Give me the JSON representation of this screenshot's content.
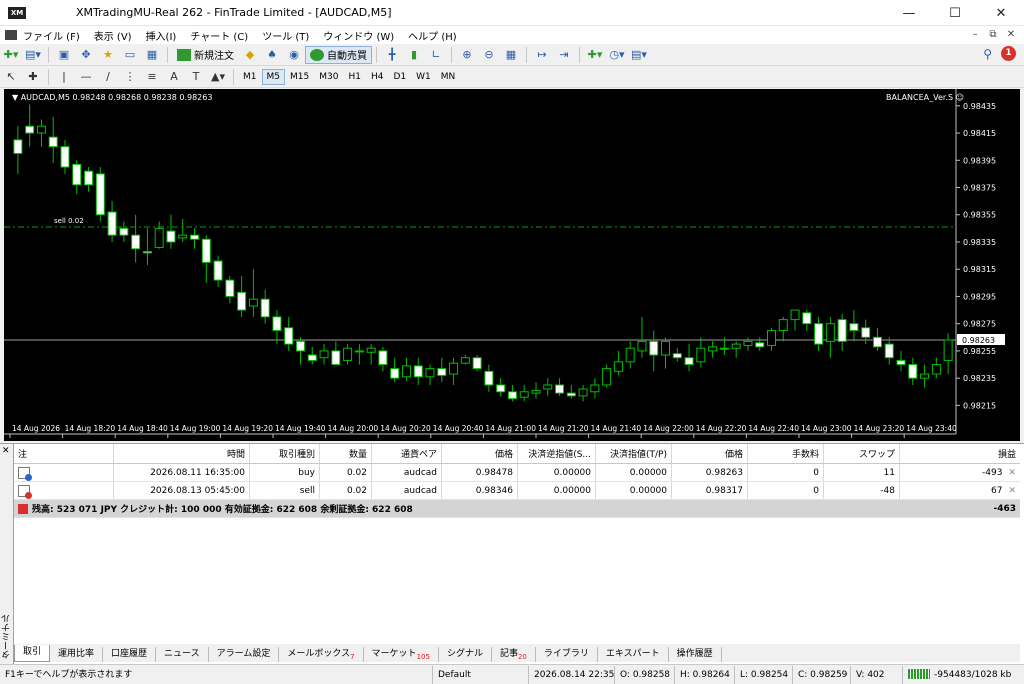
{
  "window": {
    "title": "XMTradingMU-Real 262 - FinTrade Limited - [AUDCAD,M5]",
    "logo": "XM"
  },
  "menu": [
    "ファイル (F)",
    "表示 (V)",
    "挿入(I)",
    "チャート (C)",
    "ツール (T)",
    "ウィンドウ (W)",
    "ヘルプ (H)"
  ],
  "toolbar": {
    "new_order_label": "新規注文",
    "auto_trade_label": "自動売買",
    "timeframes": [
      "M1",
      "M5",
      "M15",
      "M30",
      "H1",
      "H4",
      "D1",
      "W1",
      "MN"
    ],
    "active_timeframe": "M5",
    "notification_count": "1"
  },
  "chart": {
    "header": "AUDCAD,M5  0.98248 0.98268 0.98238 0.98263",
    "ea_label": "BALANCEA_Ver.S ☺",
    "order_label": "sell 0.02",
    "current_price_label": "0.98263",
    "colors": {
      "bg": "#000000",
      "bull": "#ffffff",
      "bear": "#ffffff",
      "wick": "#00c000",
      "sell_line": "#00a000",
      "bid_line": "#a0a0a0",
      "price_tag_bg": "#ffffff"
    }
  },
  "chart_data": {
    "type": "candlestick",
    "symbol": "AUDCAD",
    "timeframe": "M5",
    "y_ticks": [
      "0.98435",
      "0.98415",
      "0.98395",
      "0.98375",
      "0.98355",
      "0.98335",
      "0.98315",
      "0.98295",
      "0.98275",
      "0.98255",
      "0.98235",
      "0.98215"
    ],
    "ylim": [
      0.98205,
      0.9844
    ],
    "x_ticks": [
      "14 Aug 2026",
      "14 Aug 18:20",
      "14 Aug 18:40",
      "14 Aug 19:00",
      "14 Aug 19:20",
      "14 Aug 19:40",
      "14 Aug 20:00",
      "14 Aug 20:20",
      "14 Aug 20:40",
      "14 Aug 21:00",
      "14 Aug 21:20",
      "14 Aug 21:40",
      "14 Aug 22:00",
      "14 Aug 22:20",
      "14 Aug 22:40",
      "14 Aug 23:00",
      "14 Aug 23:20",
      "14 Aug 23:40"
    ],
    "sell_level": 0.98346,
    "bid_level": 0.98263,
    "candles": [
      [
        0.9841,
        0.9842,
        0.98385,
        0.984
      ],
      [
        0.9842,
        0.98436,
        0.98405,
        0.98415
      ],
      [
        0.98415,
        0.98425,
        0.98405,
        0.9842
      ],
      [
        0.98412,
        0.98427,
        0.98393,
        0.98405
      ],
      [
        0.98405,
        0.9841,
        0.98385,
        0.9839
      ],
      [
        0.98392,
        0.98395,
        0.9837,
        0.98377
      ],
      [
        0.98387,
        0.9839,
        0.98372,
        0.98377
      ],
      [
        0.98385,
        0.9839,
        0.9835,
        0.98355
      ],
      [
        0.98357,
        0.98365,
        0.98335,
        0.9834
      ],
      [
        0.98345,
        0.9835,
        0.98335,
        0.9834
      ],
      [
        0.9834,
        0.98355,
        0.9832,
        0.9833
      ],
      [
        0.98328,
        0.98345,
        0.98318,
        0.98327
      ],
      [
        0.98331,
        0.9835,
        0.9833,
        0.98345
      ],
      [
        0.98343,
        0.98355,
        0.9833,
        0.98335
      ],
      [
        0.98338,
        0.98352,
        0.98335,
        0.9834
      ],
      [
        0.9834,
        0.98345,
        0.9833,
        0.98337
      ],
      [
        0.98337,
        0.9834,
        0.98305,
        0.9832
      ],
      [
        0.98321,
        0.98325,
        0.98302,
        0.98307
      ],
      [
        0.98307,
        0.9831,
        0.9829,
        0.98295
      ],
      [
        0.98298,
        0.9831,
        0.9828,
        0.98285
      ],
      [
        0.98288,
        0.98315,
        0.9828,
        0.98293
      ],
      [
        0.98293,
        0.983,
        0.98275,
        0.9828
      ],
      [
        0.9828,
        0.98285,
        0.9826,
        0.9827
      ],
      [
        0.98272,
        0.9828,
        0.98255,
        0.9826
      ],
      [
        0.98262,
        0.98265,
        0.98245,
        0.98255
      ],
      [
        0.98252,
        0.98258,
        0.98245,
        0.98248
      ],
      [
        0.9825,
        0.9826,
        0.98245,
        0.98255
      ],
      [
        0.98255,
        0.98262,
        0.98245,
        0.98245
      ],
      [
        0.98248,
        0.9826,
        0.98245,
        0.98257
      ],
      [
        0.98255,
        0.9826,
        0.98245,
        0.98255
      ],
      [
        0.98254,
        0.9826,
        0.98245,
        0.98257
      ],
      [
        0.98255,
        0.98258,
        0.9824,
        0.98245
      ],
      [
        0.98242,
        0.9825,
        0.98232,
        0.98235
      ],
      [
        0.98236,
        0.9825,
        0.98233,
        0.98244
      ],
      [
        0.98244,
        0.9825,
        0.9823,
        0.98236
      ],
      [
        0.98236,
        0.98245,
        0.9823,
        0.98242
      ],
      [
        0.98242,
        0.9825,
        0.98232,
        0.98237
      ],
      [
        0.98238,
        0.9825,
        0.9823,
        0.98246
      ],
      [
        0.98246,
        0.98252,
        0.98245,
        0.9825
      ],
      [
        0.9825,
        0.98252,
        0.9824,
        0.98242
      ],
      [
        0.9824,
        0.98245,
        0.98225,
        0.9823
      ],
      [
        0.9823,
        0.98235,
        0.98222,
        0.98225
      ],
      [
        0.98225,
        0.9823,
        0.98218,
        0.9822
      ],
      [
        0.98221,
        0.9823,
        0.98218,
        0.98225
      ],
      [
        0.98224,
        0.98232,
        0.9822,
        0.98226
      ],
      [
        0.98227,
        0.98235,
        0.98222,
        0.9823
      ],
      [
        0.9823,
        0.98235,
        0.98222,
        0.98224
      ],
      [
        0.98224,
        0.9823,
        0.9822,
        0.98222
      ],
      [
        0.98222,
        0.9823,
        0.98218,
        0.98227
      ],
      [
        0.98225,
        0.98235,
        0.9822,
        0.9823
      ],
      [
        0.9823,
        0.98245,
        0.98228,
        0.98242
      ],
      [
        0.9824,
        0.98255,
        0.98237,
        0.98247
      ],
      [
        0.98247,
        0.98262,
        0.98242,
        0.98257
      ],
      [
        0.98255,
        0.9828,
        0.9825,
        0.98262
      ],
      [
        0.98262,
        0.9827,
        0.9824,
        0.98252
      ],
      [
        0.98252,
        0.98265,
        0.98242,
        0.98262
      ],
      [
        0.98253,
        0.98257,
        0.98247,
        0.9825
      ],
      [
        0.9825,
        0.9826,
        0.9824,
        0.98245
      ],
      [
        0.98247,
        0.98265,
        0.98243,
        0.98257
      ],
      [
        0.98255,
        0.98262,
        0.9825,
        0.98258
      ],
      [
        0.98257,
        0.98265,
        0.98252,
        0.98257
      ],
      [
        0.98257,
        0.98262,
        0.9825,
        0.9826
      ],
      [
        0.98259,
        0.98265,
        0.98255,
        0.98262
      ],
      [
        0.98261,
        0.98265,
        0.98255,
        0.98258
      ],
      [
        0.98259,
        0.98272,
        0.98255,
        0.9827
      ],
      [
        0.9827,
        0.9828,
        0.98262,
        0.98278
      ],
      [
        0.98278,
        0.98285,
        0.9827,
        0.98285
      ],
      [
        0.98283,
        0.98285,
        0.9827,
        0.98275
      ],
      [
        0.98275,
        0.9828,
        0.98255,
        0.9826
      ],
      [
        0.98262,
        0.9828,
        0.9825,
        0.98275
      ],
      [
        0.98278,
        0.98282,
        0.98255,
        0.98262
      ],
      [
        0.98275,
        0.98285,
        0.98262,
        0.9827
      ],
      [
        0.98272,
        0.98278,
        0.9826,
        0.98265
      ],
      [
        0.98265,
        0.98272,
        0.98255,
        0.98258
      ],
      [
        0.9826,
        0.98265,
        0.98245,
        0.9825
      ],
      [
        0.98248,
        0.98255,
        0.9824,
        0.98245
      ],
      [
        0.98245,
        0.9825,
        0.9823,
        0.98235
      ],
      [
        0.98235,
        0.98245,
        0.98228,
        0.98238
      ],
      [
        0.98238,
        0.9825,
        0.98235,
        0.98245
      ],
      [
        0.98248,
        0.98268,
        0.98238,
        0.98263
      ]
    ]
  },
  "terminal": {
    "headers": [
      "注",
      "時間",
      "取引種別",
      "数量",
      "通貨ペア",
      "価格",
      "決済逆指値(S...",
      "決済指値(T/P)",
      "価格",
      "手数料",
      "スワップ",
      "損益"
    ],
    "rows": [
      {
        "time": "2026.08.11 16:35:00",
        "type": "buy",
        "volume": "0.02",
        "symbol": "audcad",
        "price": "0.98478",
        "sl": "0.00000",
        "tp": "0.00000",
        "current": "0.98263",
        "commission": "0",
        "swap": "11",
        "profit": "-493",
        "marker": "blue"
      },
      {
        "time": "2026.08.13 05:45:00",
        "type": "sell",
        "volume": "0.02",
        "symbol": "audcad",
        "price": "0.98346",
        "sl": "0.00000",
        "tp": "0.00000",
        "current": "0.98317",
        "commission": "0",
        "swap": "-48",
        "profit": "67",
        "marker": "red"
      }
    ],
    "summary": "残高: 523 071 JPY  クレジット計: 100 000  有効証拠金: 622 608  余剰証拠金: 622 608",
    "summary_profit": "-463",
    "side_label": "ターミナル",
    "tabs": [
      {
        "label": "取引",
        "badge": ""
      },
      {
        "label": "運用比率",
        "badge": ""
      },
      {
        "label": "口座履歴",
        "badge": ""
      },
      {
        "label": "ニュース",
        "badge": ""
      },
      {
        "label": "アラーム設定",
        "badge": ""
      },
      {
        "label": "メールボックス",
        "badge": "7"
      },
      {
        "label": "マーケット",
        "badge": "105"
      },
      {
        "label": "シグナル",
        "badge": ""
      },
      {
        "label": "記事",
        "badge": "20"
      },
      {
        "label": "ライブラリ",
        "badge": ""
      },
      {
        "label": "エキスパート",
        "badge": ""
      },
      {
        "label": "操作履歴",
        "badge": ""
      }
    ]
  },
  "status": {
    "help": "F1キーでヘルプが表示されます",
    "profile": "Default",
    "datetime": "2026.08.14 22:35",
    "open": "O: 0.98258",
    "high": "H: 0.98264",
    "low": "L: 0.98254",
    "close": "C: 0.98259",
    "volume": "V: 402",
    "traffic": "-954483/1028 kb"
  }
}
